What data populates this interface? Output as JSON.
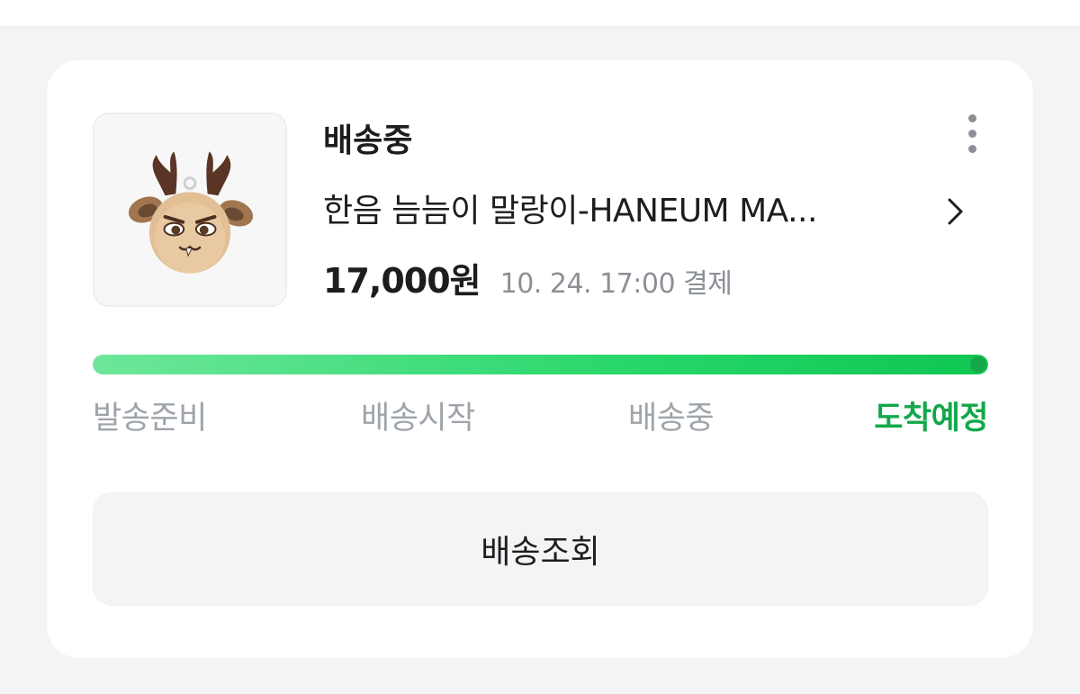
{
  "order": {
    "status": "배송중",
    "product_name": "한음 늠늠이 말랑이-HANEUM MA...",
    "price": "17,000원",
    "paid_at": "10. 24. 17:00 결제",
    "product_image_icon": "deer-plush-keychain"
  },
  "progress": {
    "value_percent": 100,
    "accent_color": "#12a84a",
    "steps": [
      {
        "label": "발송준비",
        "active": false
      },
      {
        "label": "배송시작",
        "active": false
      },
      {
        "label": "배송중",
        "active": false
      },
      {
        "label": "도착예정",
        "active": true
      }
    ]
  },
  "actions": {
    "track_label": "배송조회",
    "more_icon": "more-vertical-icon",
    "detail_icon": "chevron-right-icon"
  }
}
